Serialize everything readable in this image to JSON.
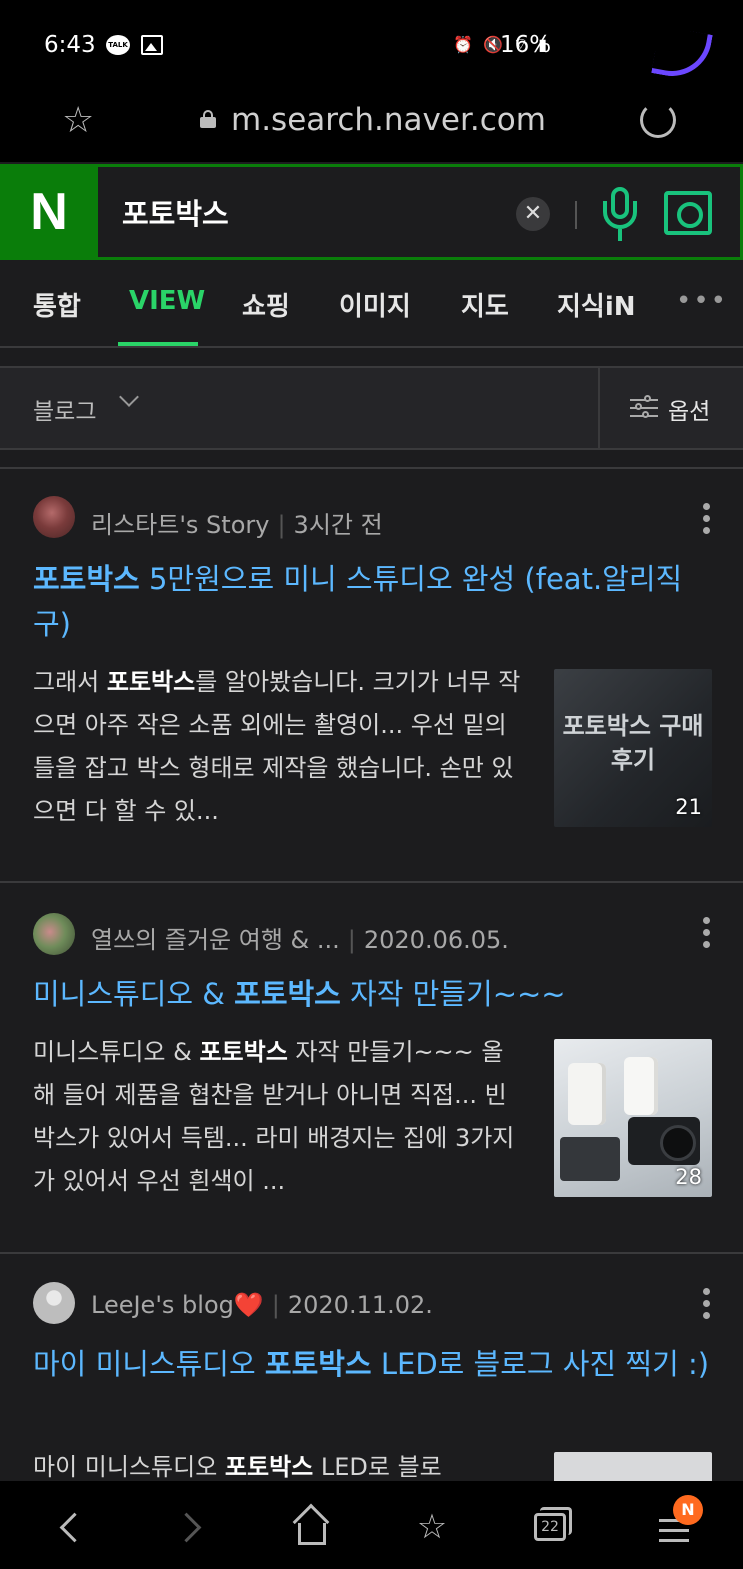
{
  "status_bar": {
    "time": "6:43",
    "talk_icon_label": "TALK",
    "battery": "16%",
    "icons": [
      "talk-icon",
      "image-icon",
      "alarm-icon",
      "mute-icon",
      "wifi-icon",
      "signal-icon"
    ]
  },
  "browser": {
    "url": "m.search.naver.com",
    "tab_count": "22",
    "menu_badge": "N"
  },
  "search": {
    "logo": "N",
    "query": "포토박스",
    "clear_symbol": "✕"
  },
  "tabs": [
    {
      "label": "통합"
    },
    {
      "label": "VIEW",
      "active": true
    },
    {
      "label": "쇼핑"
    },
    {
      "label": "이미지"
    },
    {
      "label": "지도"
    },
    {
      "label": "지식iN"
    }
  ],
  "tabs_more": "•••",
  "filter": {
    "category": "블로그",
    "options_label": "옵션"
  },
  "results": [
    {
      "author": "리스타트's Story",
      "date": "3시간 전",
      "title_pre": "",
      "title_hl": "포토박스",
      "title_post": " 5만원으로 미니 스튜디오 완성 (feat.알리직구)",
      "snippet_pre": "그래서 ",
      "snippet_hl": "포토박스",
      "snippet_post": "를 알아봤습니다. 크기가 너무 작으면 아주 작은 소품 외에는 촬영이... 우선 밑의 틀을 잡고 박스 형태로 제작을 했습니다. 손만 있으면 다 할 수 있...",
      "thumb_text": "포토박스 구매후기",
      "image_count": "21"
    },
    {
      "author": "열쓰의 즐거운 여행 & ...",
      "date": "2020.06.05.",
      "title_pre": "미니스튜디오 & ",
      "title_hl": "포토박스",
      "title_post": " 자작 만들기~~~",
      "snippet_pre": "미니스튜디오 & ",
      "snippet_hl": "포토박스",
      "snippet_post": " 자작 만들기~~~ 올해 들어 제품을 협찬을 받거나 아니면 직접... 빈 박스가 있어서 득템... 라미 배경지는 집에 3가지가 있어서 우선 흰색이 ...",
      "image_count": "28"
    },
    {
      "author": "LeeJe's blog❤️",
      "date": "2020.11.02.",
      "title_pre": "마이 미니스튜디오 ",
      "title_hl": "포토박스",
      "title_post": " LED로 블로그 사진 찍기 :)",
      "snippet_pre": "마이 미니스튜디오 ",
      "snippet_hl": "포토박스",
      "snippet_post": " LED로 블로"
    }
  ],
  "colors": {
    "naver_green": "#0a7d0a",
    "active_tab": "#2ad468",
    "title_link": "#5cb8ff",
    "badge": "#ff6a1f"
  }
}
